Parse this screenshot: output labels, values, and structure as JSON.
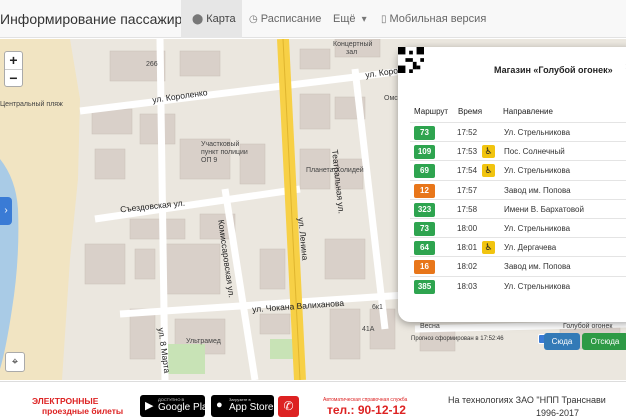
{
  "nav": {
    "brand": "Информирование пассажиров",
    "items": [
      {
        "label": "Карта",
        "icon": "map-marker-icon",
        "active": true
      },
      {
        "label": "Расписание",
        "icon": "clock-icon"
      },
      {
        "label": "Ещё",
        "icon": "caret-down-icon"
      },
      {
        "label": "Мобильная версия",
        "icon": "mobile-icon"
      }
    ]
  },
  "map": {
    "zoom_in": "+",
    "zoom_out": "−",
    "labels": {
      "beach": "Центральный пляж",
      "korolenko1": "ул. Короленко",
      "korolenko2": "ул. Короленко",
      "police": "Участковый\nпункт полиции\nОП 9",
      "police_l1": "Участковый",
      "police_l2": "пункт полиции",
      "police_l3": "ОП 9",
      "planet": "Планета Холидей",
      "theatre_st": "Театральная ул.",
      "sezd": "Съездовская ул.",
      "komiss": "Комиссаровская ул.",
      "lenina": "ул. Ленина",
      "chokana": "ул. Чокана Валиханова",
      "marta": "ул. 8 Марта",
      "ultramed": "Ультрамед",
      "concert1": "Концертный",
      "concert2": "зал",
      "ons": "Омс",
      "blue_fire": "Голубой огонек",
      "vesna": "Весна",
      "b266": "266",
      "b41a": "41А",
      "b6k1": "6к1"
    }
  },
  "popup": {
    "stop_name": "Магазин «Голубой огонек»",
    "headers": {
      "route": "Маршрут",
      "time": "Время",
      "direction": "Направление"
    },
    "rows": [
      {
        "route": "73",
        "color": "#2ea44f",
        "time": "17:52",
        "wheelchair": false,
        "direction": "Ул. Стрельникова"
      },
      {
        "route": "109",
        "color": "#2ea44f",
        "time": "17:53",
        "wheelchair": true,
        "direction": "Пос. Солнечный"
      },
      {
        "route": "69",
        "color": "#2ea44f",
        "time": "17:54",
        "wheelchair": true,
        "direction": "Ул. Стрельникова"
      },
      {
        "route": "12",
        "color": "#e8761a",
        "time": "17:57",
        "wheelchair": false,
        "direction": "Завод им. Попова"
      },
      {
        "route": "323",
        "color": "#2ea44f",
        "time": "17:58",
        "wheelchair": false,
        "direction": "Имени В. Бархатовой"
      },
      {
        "route": "73",
        "color": "#2ea44f",
        "time": "18:00",
        "wheelchair": false,
        "direction": "Ул. Стрельникова"
      },
      {
        "route": "64",
        "color": "#2ea44f",
        "time": "18:01",
        "wheelchair": true,
        "direction": "Ул. Дергачева"
      },
      {
        "route": "16",
        "color": "#e8761a",
        "time": "18:02",
        "wheelchair": false,
        "direction": "Завод им. Попова"
      },
      {
        "route": "385",
        "color": "#2ea44f",
        "time": "18:03",
        "wheelchair": false,
        "direction": "Ул. Стрельникова"
      }
    ],
    "note": "Прогноз сформирован в 17:52:46",
    "btn_to": "Сюда",
    "btn_from": "Отсюда",
    "btn_to_color": "#337ab7",
    "btn_from_color": "#2e9a45"
  },
  "footer": {
    "ticket_title": "ЭЛЕКТРОННЫЕ",
    "ticket_sub": "проездные билеты",
    "gp_small": "ДОСТУПНО В",
    "gp_big": "Google Play",
    "as_small": "Загрузите в",
    "as_big": "App Store",
    "phone_small": "Автоматическая справочная служба",
    "phone_big": "тел.: 90-12-12",
    "credits1": "На технологиях ЗАО \"НПП Транснави",
    "credits2": "1996-2017"
  }
}
